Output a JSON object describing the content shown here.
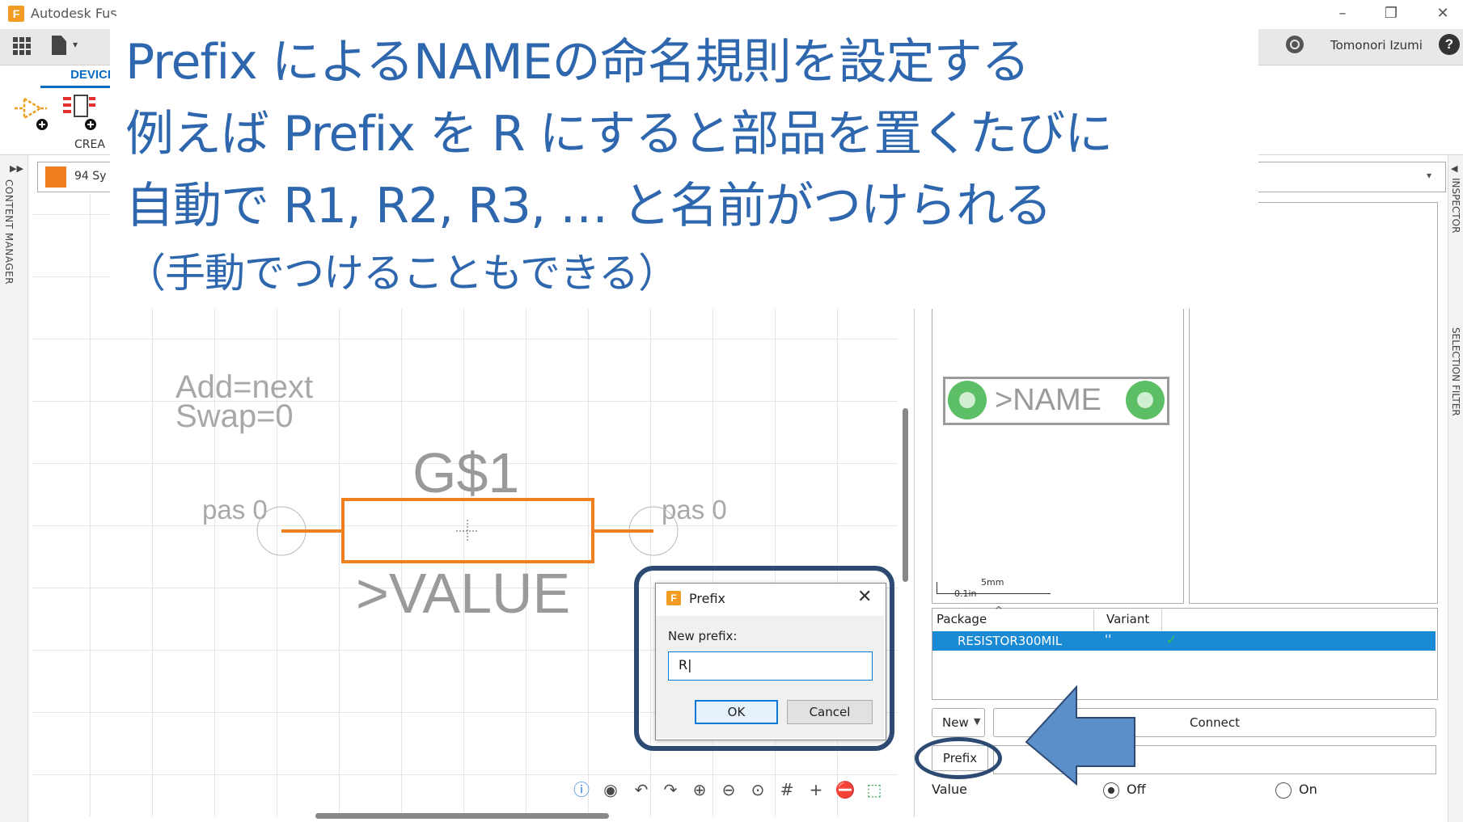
{
  "window": {
    "app_title": "Autodesk Fus",
    "logo_letter": "F",
    "minimize": "–",
    "restore": "❐",
    "close": "✕",
    "user": "Tomonori Izumi"
  },
  "ribbon": {
    "active_tab": "DEVICE",
    "create_label": "CREA"
  },
  "left_panel": {
    "content_manager": "CONTENT MANAGER",
    "layer_label": "94 Sy",
    "layer_color": "#f0801f"
  },
  "right_panel_labels": {
    "inspector": "INSPECTOR",
    "selection_filter": "SELECTION FILTER"
  },
  "canvas": {
    "add_text": "Add=next",
    "swap_text": "Swap=0",
    "gate_name": "G$1",
    "pin_left": "pas 0",
    "pin_right": "pas 0",
    "value_text": ">VALUE",
    "symbol_color": "#f0801f"
  },
  "package_preview": {
    "name_text": ">NAME",
    "scale_mm": "5mm",
    "scale_in": "0.1in"
  },
  "package_table": {
    "columns": [
      "Package",
      "Variant"
    ],
    "rows": [
      {
        "package": "RESISTOR300MIL",
        "variant": "''",
        "check": "✓"
      }
    ]
  },
  "device_controls": {
    "new_label": "New",
    "connect_label": "Connect",
    "prefix_label": "Prefix",
    "value_label": "Value",
    "off_label": "Off",
    "on_label": "On",
    "value_selected": "Off"
  },
  "prefix_dialog": {
    "title": "Prefix",
    "close": "✕",
    "prompt": "New prefix:",
    "input_value": "R|",
    "ok_label": "OK",
    "cancel_label": "Cancel"
  },
  "callout": {
    "line1": "Prefix によるNAMEの命名規則を設定する",
    "line2": "例えば Prefix を R にすると部品を置くたびに",
    "line3": "自動で R1, R2, R3, … と名前がつけられる",
    "line4": "（手動でつけることもできる）",
    "text_color": "#2e67ad",
    "arrow_color": "#5b8fc9"
  }
}
